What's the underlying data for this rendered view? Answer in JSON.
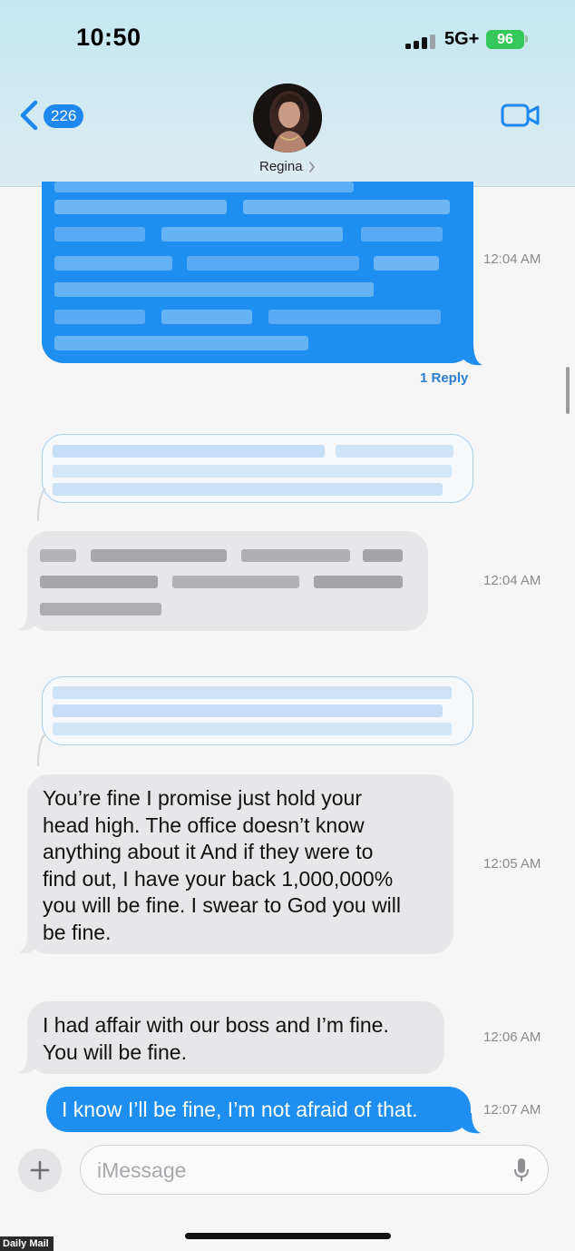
{
  "status_bar": {
    "time": "10:50",
    "network": "5G+",
    "battery": "96"
  },
  "header": {
    "back_count": "226",
    "contact_name": "Regina"
  },
  "messages": {
    "m1_timestamp": "12:04 AM",
    "m1_reply_label": "1 Reply",
    "m3_timestamp": "12:04 AM",
    "m5_timestamp": "12:05 AM",
    "m5_lines": [
      "You’re fine I promise just hold your",
      "head high. The office doesn’t know",
      "anything about it And if they were to",
      "find out, I have your back 1,000,000%",
      "you will be fine. I swear to God you will",
      "be fine."
    ],
    "m6_timestamp": "12:06 AM",
    "m6_lines": [
      "I had affair with our boss and I’m fine.",
      "You will be fine."
    ],
    "m7_timestamp": "12:07 AM",
    "m7_text": "I know I’ll be fine, I’m not afraid of that."
  },
  "input": {
    "placeholder": "iMessage"
  },
  "watermark": "Daily Mail",
  "colors": {
    "sent_bubble": "#1e8ff0",
    "received_bubble": "#e7e7ea",
    "header_tint": "#c4e6f1",
    "battery_green": "#34c759"
  },
  "icons": [
    "back-chevron-icon",
    "video-camera-icon",
    "plus-icon",
    "microphone-icon",
    "cellular-signal-icon",
    "battery-icon"
  ]
}
